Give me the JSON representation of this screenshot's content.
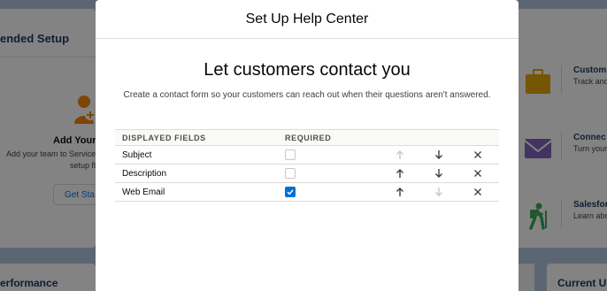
{
  "background": {
    "left_title": "ended Setup",
    "add_title": "Add Your",
    "add_desc": "Add your team to Service setup fl",
    "get_started": "Get Sta",
    "performance": "erformance",
    "current": "Current U",
    "cards": [
      {
        "title": "Custom",
        "sub": "Track and",
        "icon": "briefcase-icon",
        "color": "#e4a201"
      },
      {
        "title": "Connec",
        "sub": "Turn your",
        "icon": "envelope-icon",
        "color": "#7f5fbd"
      },
      {
        "title": "Salesfor",
        "sub": "Learn abo",
        "icon": "hiker-icon",
        "color": "#3ba755"
      }
    ]
  },
  "modal": {
    "title": "Set Up Help Center",
    "hero_title": "Let customers contact you",
    "hero_desc": "Create a contact form so your customers can reach out when their questions aren't answered.",
    "columns": {
      "fields": "DISPLAYED FIELDS",
      "required": "REQUIRED"
    },
    "rows": [
      {
        "label": "Subject",
        "required": false,
        "up_enabled": false,
        "down_enabled": true
      },
      {
        "label": "Description",
        "required": false,
        "up_enabled": true,
        "down_enabled": true
      },
      {
        "label": "Web Email",
        "required": true,
        "up_enabled": true,
        "down_enabled": false
      }
    ]
  },
  "colors": {
    "brand": "#0070d2",
    "enabled_icon": "#3e3e3c",
    "disabled_icon": "#c9c7c5"
  }
}
